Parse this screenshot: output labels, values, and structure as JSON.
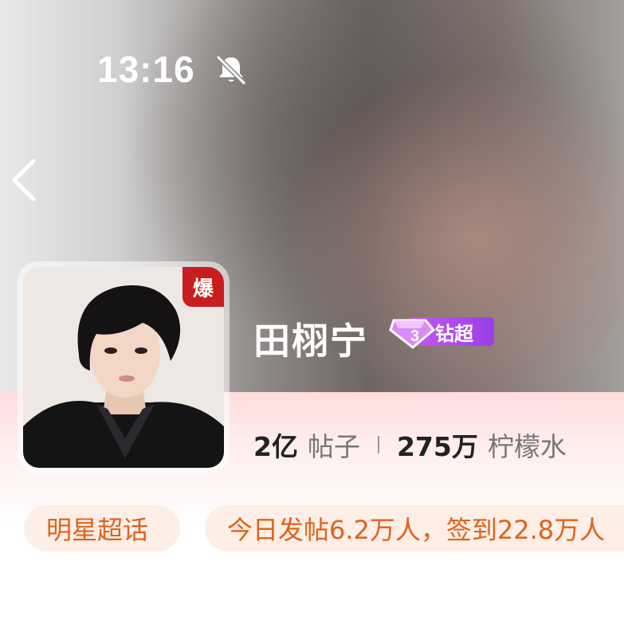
{
  "status_bar": {
    "time": "13:16",
    "mute_icon": "bell-slash-icon"
  },
  "nav": {
    "back_icon": "chevron-left-icon"
  },
  "profile": {
    "name": "田栩宁",
    "hot_badge": "爆",
    "level_badge": "钻超",
    "level_icon": "diamond-level-3-icon",
    "avatar_desc": "avatar"
  },
  "stats": {
    "posts_value": "2亿",
    "posts_label": "帖子",
    "fans_value": "275万",
    "fans_label": "柠檬水"
  },
  "tags": {
    "category": "明星超话",
    "activity": "今日发帖6.2万人，签到22.8万人"
  },
  "colors": {
    "accent_orange": "#e0621b",
    "tag_bg": "#fdeee6",
    "badge_purple": "#b04cee",
    "hot_red": "#c81e1e"
  }
}
